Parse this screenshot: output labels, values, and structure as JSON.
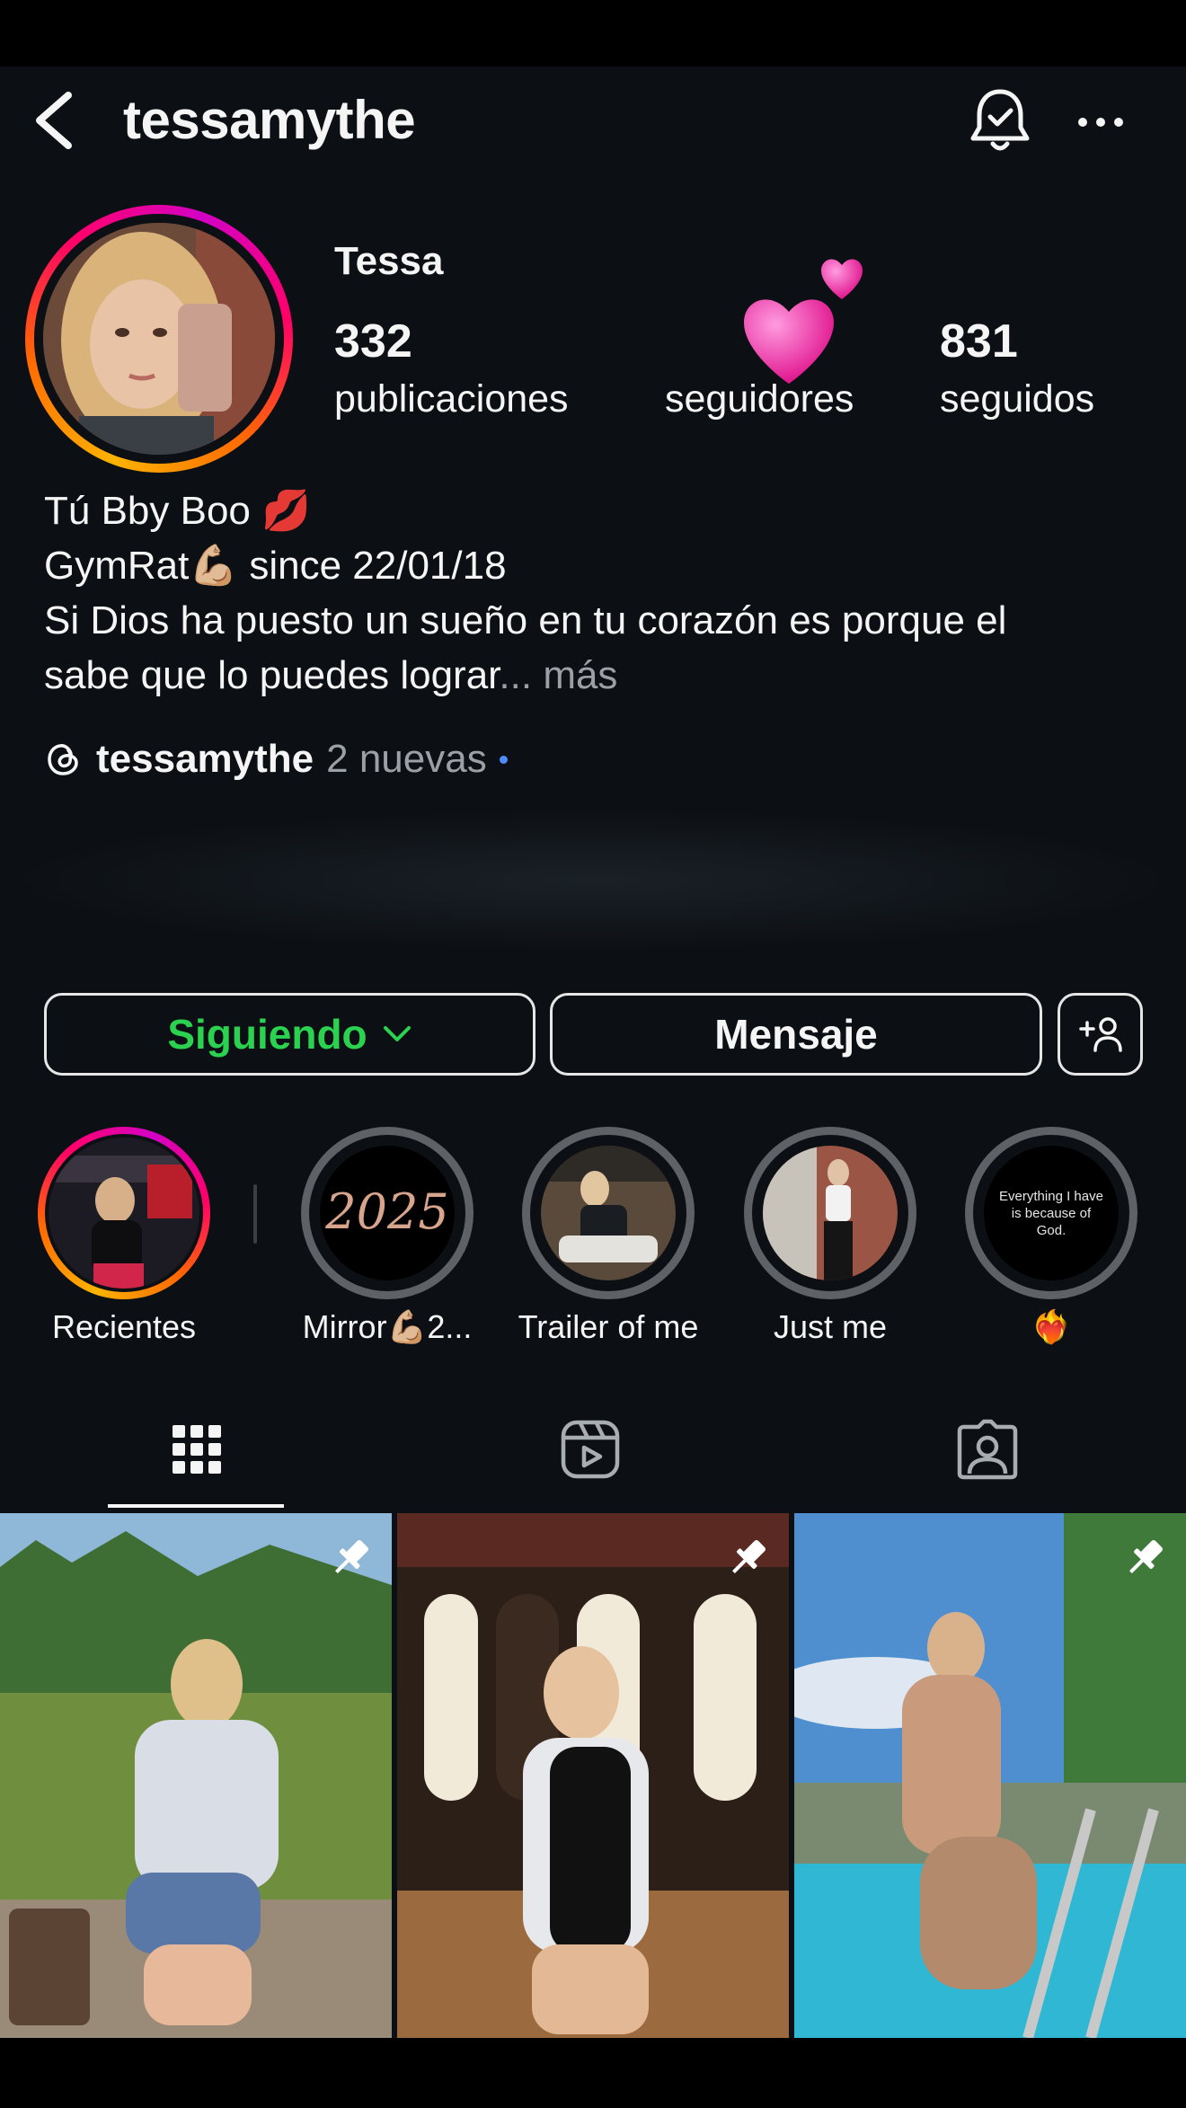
{
  "header": {
    "username": "tessamythe"
  },
  "profile": {
    "display_name": "Tessa",
    "stats": [
      {
        "value": "332",
        "label": "publicaciones"
      },
      {
        "value": "",
        "label": "seguidores"
      },
      {
        "value": "831",
        "label": "seguidos"
      }
    ],
    "bio_lines": [
      "Tú Bby Boo 💋",
      "GymRat💪🏼 since 22/01/18",
      "Si Dios ha puesto un sueño en tu corazón es porque el",
      "sabe que lo puedes lograr"
    ],
    "bio_ellipsis": "...",
    "more_label": "más",
    "threads_name": "tessamythe",
    "threads_new": "2 nuevas"
  },
  "buttons": {
    "following": "Siguiendo",
    "message": "Mensaje"
  },
  "highlights": [
    {
      "label": "Recientes"
    },
    {
      "label": "Mirror💪🏼2..."
    },
    {
      "label": "Trailer of me"
    },
    {
      "label": "Just me"
    },
    {
      "label": "❤️‍🔥"
    }
  ],
  "highlight_texts": {
    "year": "2025",
    "quote": "Everything I have is because of God."
  },
  "colors": {
    "background": "#0c1014",
    "following_green": "#2bd24f",
    "new_dot": "#4f8cff"
  }
}
